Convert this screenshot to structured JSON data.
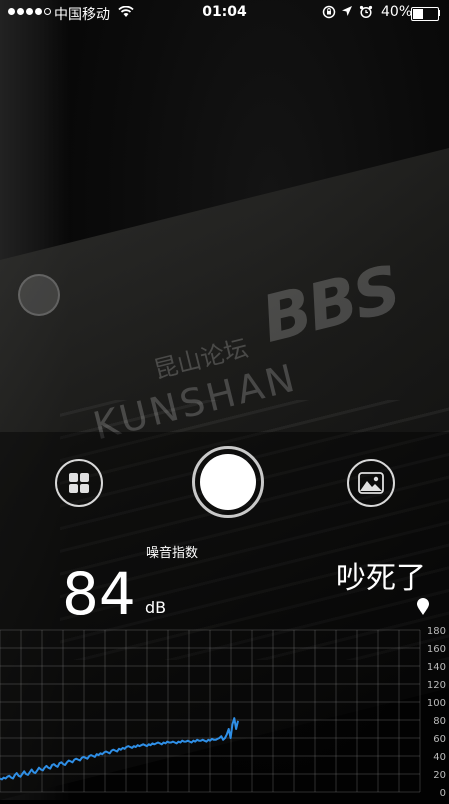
{
  "status_bar": {
    "signal_bars": 4,
    "signal_total": 5,
    "carrier": "中国移动",
    "time": "01:04",
    "battery_text": "40%",
    "battery_level": 0.4
  },
  "watermark": {
    "cn": "昆山论坛",
    "bbs": "BBS",
    "en": "KUNSHAN"
  },
  "meter": {
    "label": "噪音指数",
    "value": "84",
    "unit": "dB",
    "verdict": "吵死了"
  },
  "icons": {
    "grid": "grid-icon",
    "gallery": "gallery-icon",
    "shutter": "shutter-button",
    "location": "location-pin-icon"
  },
  "colors": {
    "line": "#2f8fe6",
    "grid": "rgba(130,130,130,0.35)"
  },
  "chart_data": {
    "type": "line",
    "ylim": [
      0,
      180
    ],
    "yticks": [
      "180",
      "160",
      "140",
      "120",
      "100",
      "80",
      "60",
      "40",
      "20",
      "0"
    ],
    "values": [
      15,
      14,
      16,
      15,
      17,
      18,
      16,
      15,
      19,
      21,
      18,
      17,
      20,
      23,
      20,
      19,
      22,
      25,
      22,
      21,
      24,
      27,
      25,
      24,
      27,
      29,
      27,
      26,
      30,
      31,
      29,
      28,
      32,
      33,
      31,
      30,
      33,
      35,
      34,
      33,
      36,
      37,
      36,
      35,
      38,
      39,
      38,
      37,
      40,
      41,
      40,
      39,
      42,
      41,
      43,
      42,
      44,
      45,
      44,
      43,
      46,
      47,
      46,
      45,
      48,
      47,
      49,
      48,
      50,
      51,
      50,
      49,
      51,
      50,
      52,
      51,
      52,
      53,
      52,
      51,
      53,
      52,
      54,
      53,
      54,
      55,
      54,
      53,
      55,
      54,
      56,
      55,
      55,
      56,
      55,
      54,
      56,
      55,
      57,
      56,
      56,
      57,
      56,
      55,
      57,
      56,
      58,
      57,
      57,
      58,
      57,
      56,
      58,
      57,
      59,
      58,
      58,
      59,
      60,
      62,
      58,
      60,
      64,
      70,
      60,
      75,
      82,
      70,
      79
    ]
  }
}
